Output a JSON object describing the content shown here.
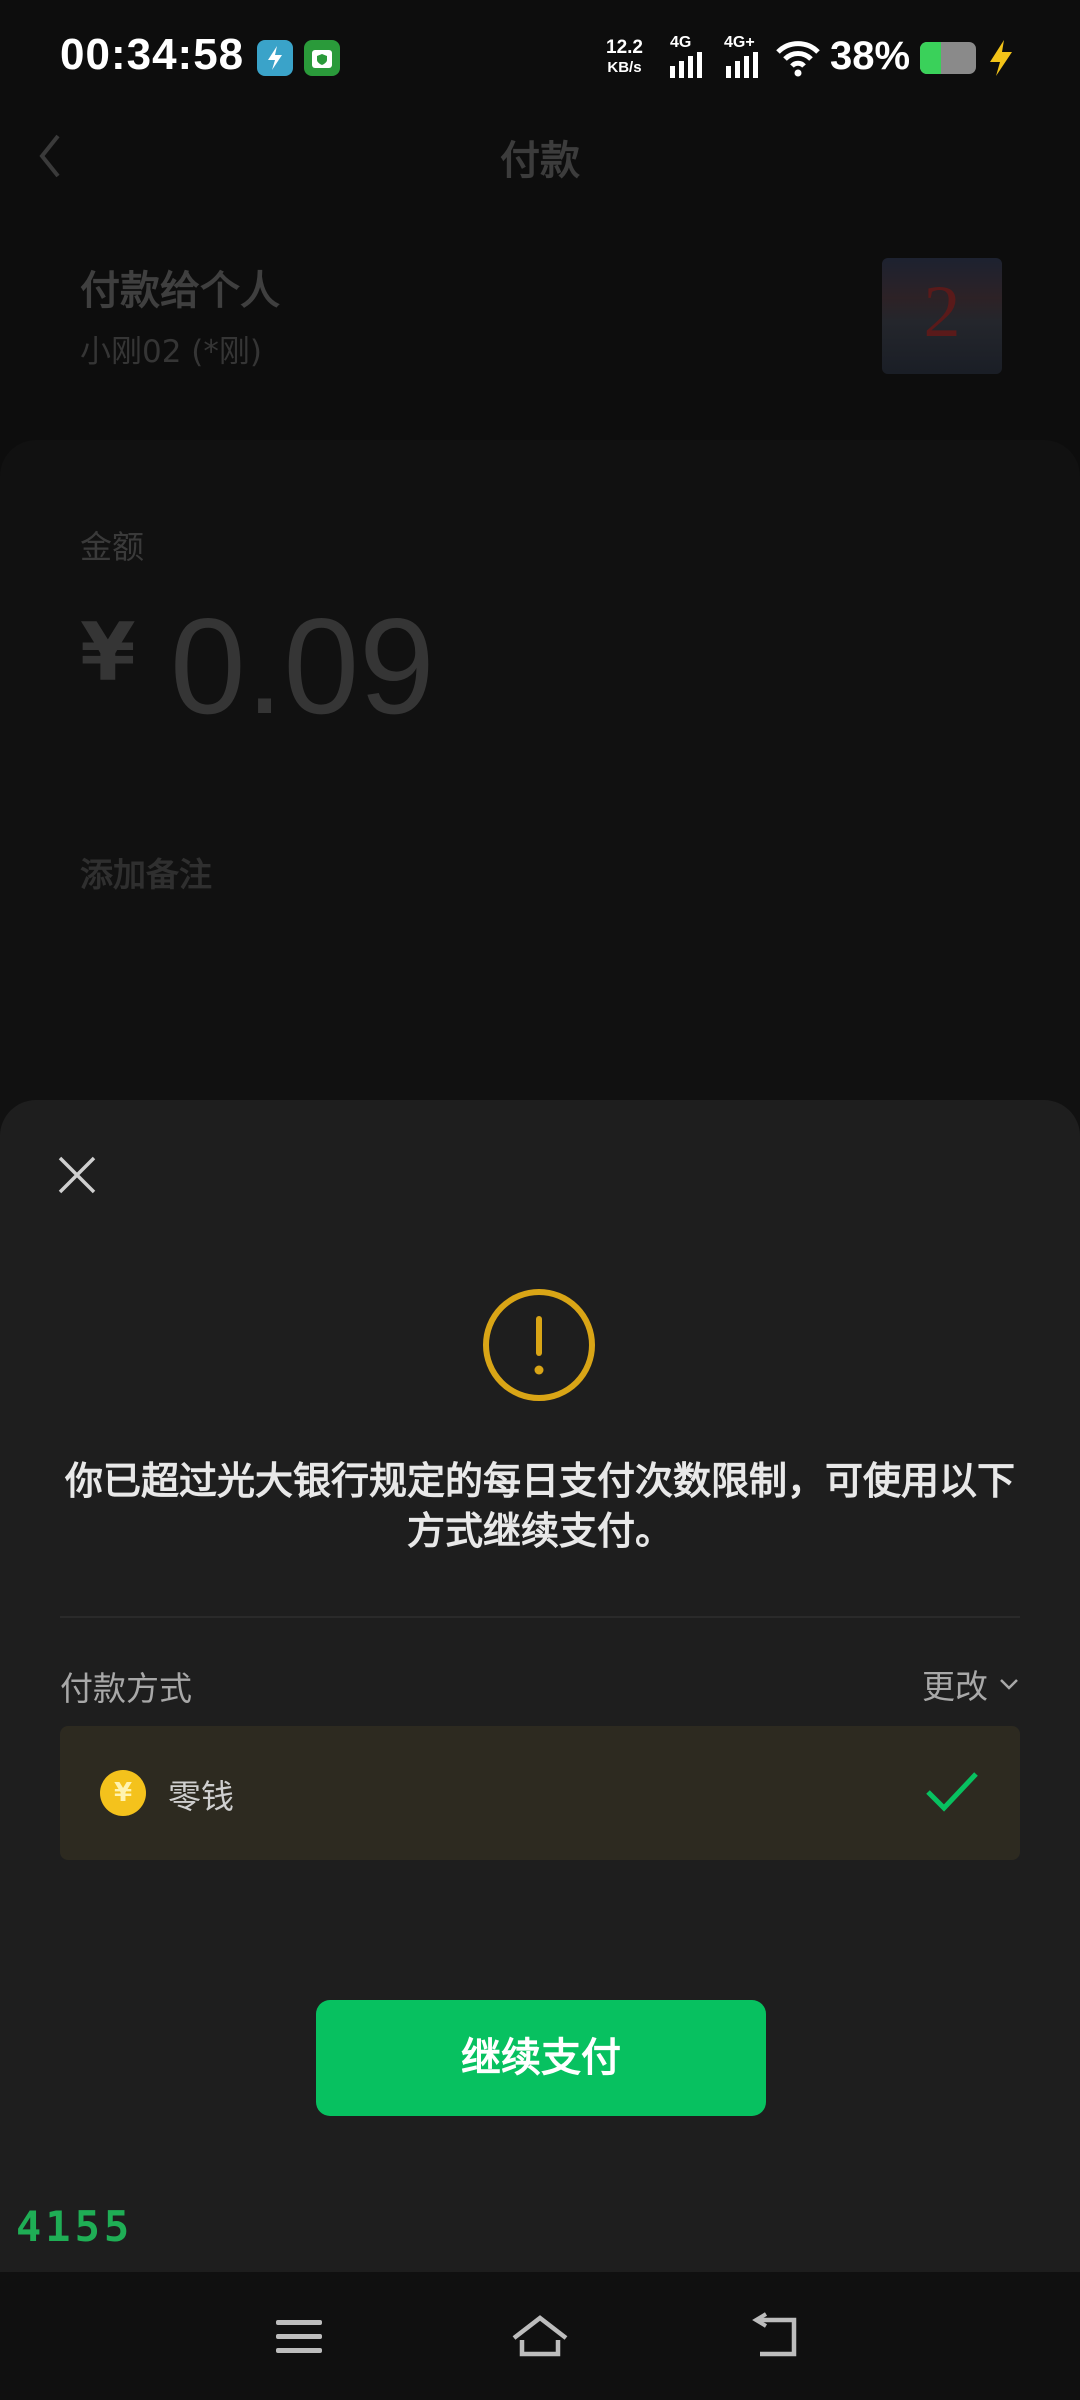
{
  "status_bar": {
    "time": "00:34:58",
    "net_speed_value": "12.2",
    "net_speed_unit": "KB/s",
    "network_1": "4G",
    "network_2": "4G+",
    "battery_percent": "38%",
    "battery_level": 0.38
  },
  "header": {
    "title": "付款"
  },
  "payee": {
    "title": "付款给个人",
    "name": "小刚02 (*刚)",
    "avatar_text": "2"
  },
  "amount": {
    "label": "金额",
    "currency": "¥",
    "value": "0.09",
    "remark_link": "添加备注"
  },
  "sheet": {
    "message": "你已超过光大银行规定的每日支付次数限制，可使用以下方式继续支付。",
    "payment_method_label": "付款方式",
    "change_label": "更改",
    "selected_method": {
      "name": "零钱",
      "icon_text": "¥"
    },
    "continue_button": "继续支付"
  },
  "overlay_counter": "4155",
  "colors": {
    "primary_green": "#07c160",
    "warning_yellow": "#d9a516",
    "coin_yellow": "#f4c21c",
    "sheet_bg": "#1e1e1e"
  },
  "icons": [
    "back-arrow-icon",
    "close-icon",
    "warning-icon",
    "chevron-down-icon",
    "coin-icon",
    "checkmark-icon",
    "menu-icon",
    "home-icon",
    "back-icon"
  ]
}
